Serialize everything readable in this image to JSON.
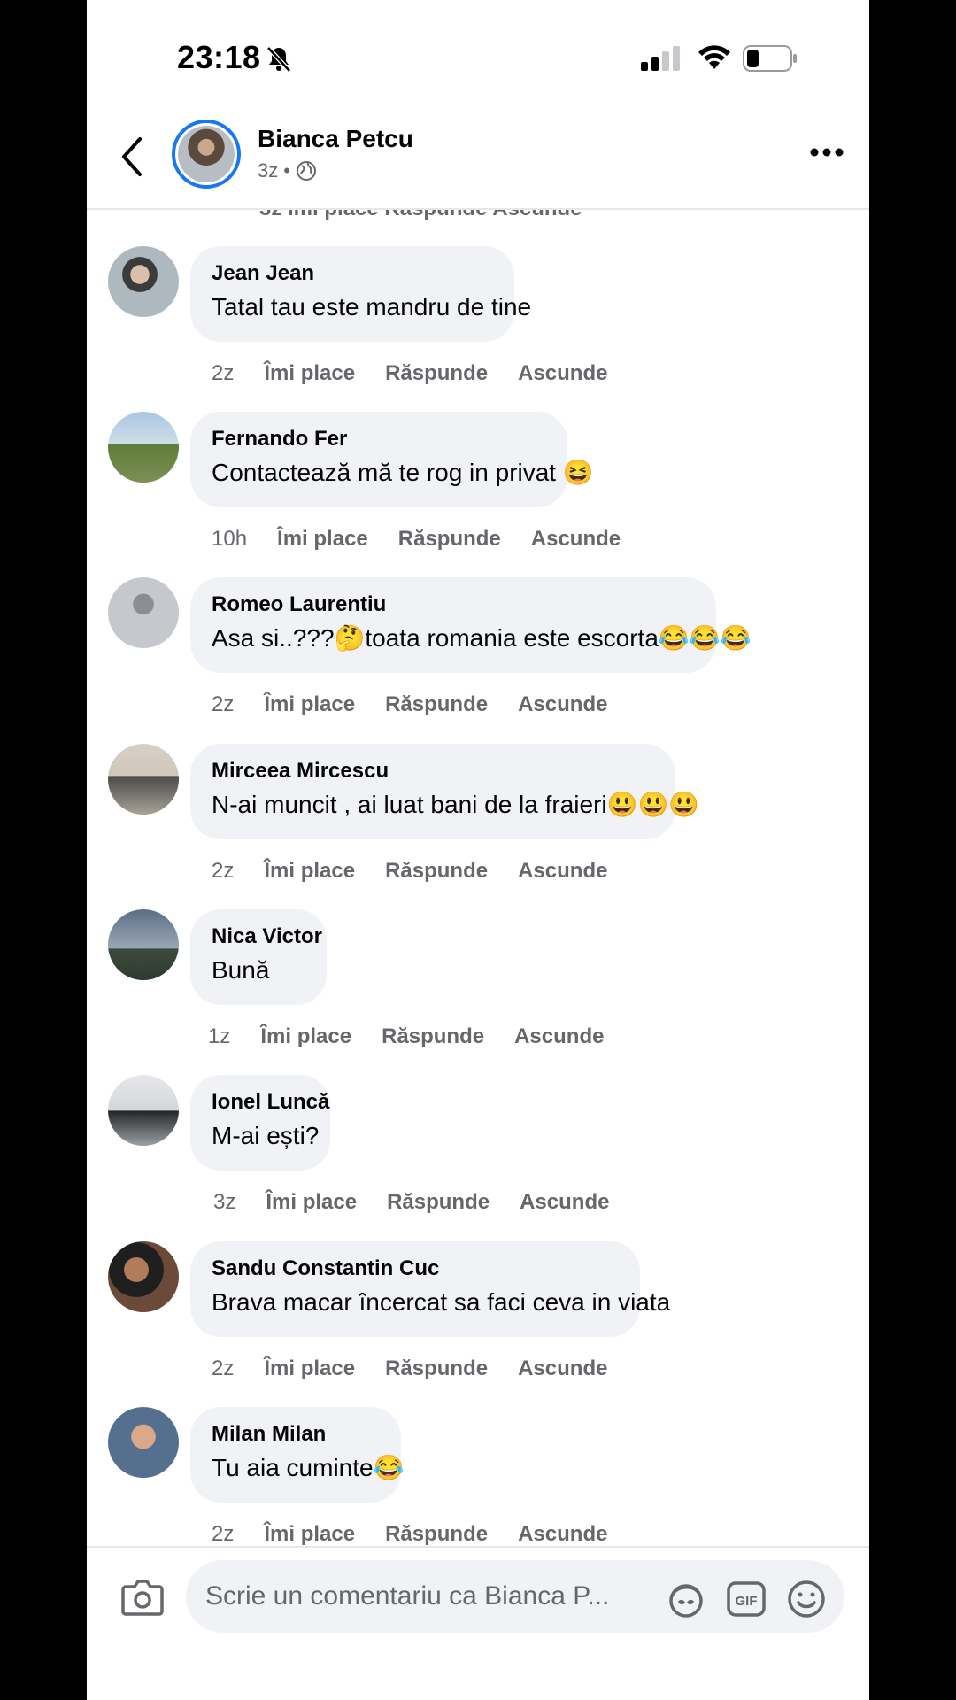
{
  "status": {
    "time": "23:18"
  },
  "header": {
    "name": "Bianca Petcu",
    "age": "3z",
    "dot": "•"
  },
  "partial_row": "3z  Îmi place  Răspunde  Ascunde",
  "actions_labels": {
    "like": "Îmi place",
    "reply": "Răspunde",
    "hide": "Ascunde"
  },
  "comments": [
    {
      "name": "Jean Jean",
      "text": "Tatal tau este mandru de tine",
      "time": "2z"
    },
    {
      "name": "Fernando Fer",
      "text": "Contactează mă te rog in privat 😆",
      "time": "10h"
    },
    {
      "name": "Romeo Laurentiu",
      "text": "Asa si..???🤔toata romania este escorta😂😂😂",
      "time": "2z"
    },
    {
      "name": "Mirceea Mircescu",
      "text": "N-ai muncit , ai luat bani de la fraieri😃😃😃",
      "time": "2z"
    },
    {
      "name": "Nica Victor",
      "text": "Bună",
      "time": "1z"
    },
    {
      "name": "Ionel Luncă",
      "text": "M-ai ești?",
      "time": "3z"
    },
    {
      "name": "Sandu Constantin Cuc",
      "text": "Brava  macar încercat sa faci ceva in viata",
      "time": "2z"
    },
    {
      "name": "Milan Milan",
      "text": "Tu aia cuminte😂",
      "time": "2z"
    }
  ],
  "composer": {
    "placeholder": "Scrie un comentariu ca Bianca P..."
  },
  "colors": {
    "accent": "#1877f2",
    "bubble": "#f0f2f5",
    "muted": "#65676b"
  }
}
